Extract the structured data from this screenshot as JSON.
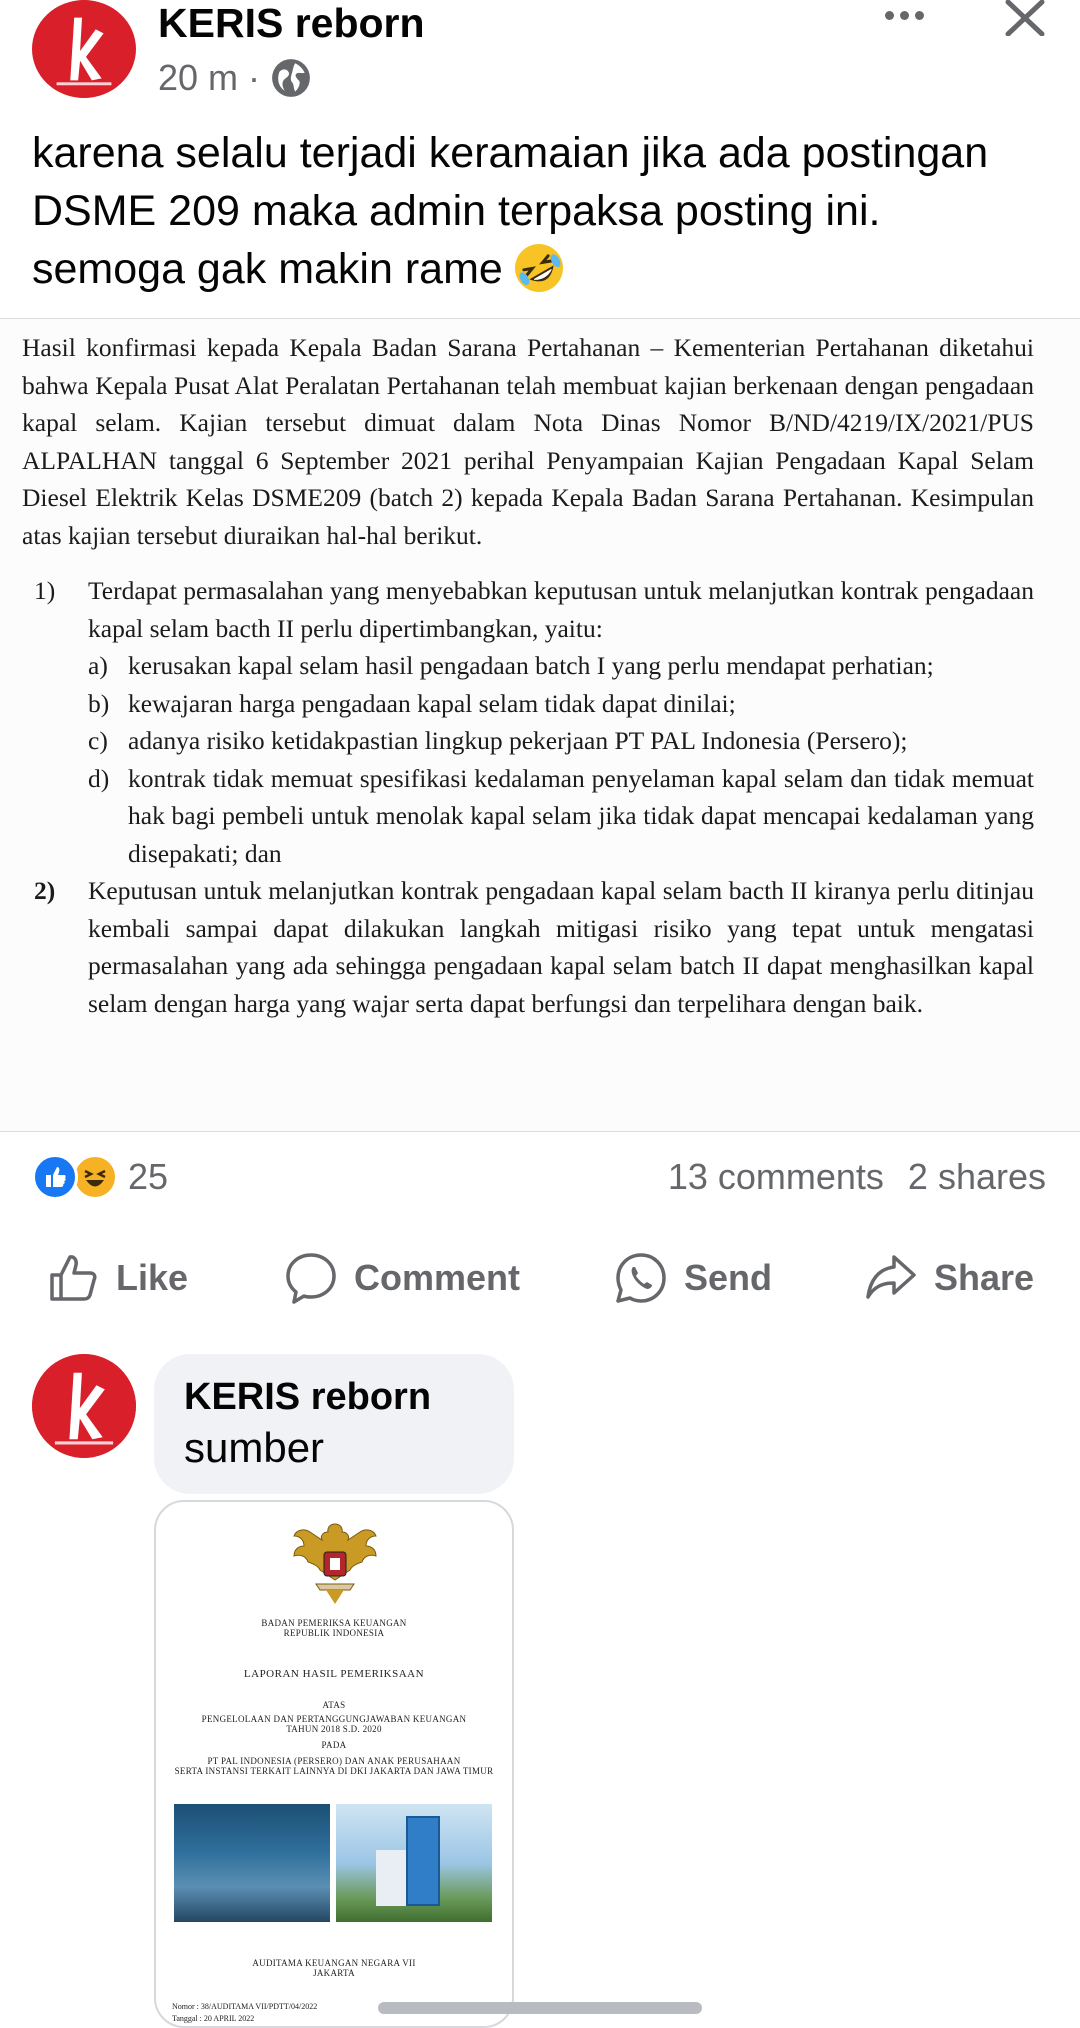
{
  "post": {
    "author": "KERIS reborn",
    "time": "20 m ·",
    "caption_lines": [
      "karena selalu terjadi keramaian jika ada postingan",
      "DSME 209 maka admin terpaksa posting ini.",
      "semoga gak makin rame"
    ],
    "caption_emoji": "rolling-on-floor-laughing-emoji"
  },
  "document": {
    "paragraph": "Hasil konfirmasi kepada Kepala Badan Sarana Pertahanan – Kementerian Pertahanan diketahui bahwa Kepala Pusat Alat Peralatan Pertahanan telah membuat kajian berkenaan dengan pengadaan kapal selam. Kajian tersebut dimuat dalam Nota Dinas Nomor B/ND/4219/IX/2021/PUS ALPALHAN tanggal 6 September 2021 perihal Penyampaian Kajian Pengadaan Kapal Selam Diesel Elektrik Kelas DSME209 (batch 2) kepada Kepala Badan Sarana Pertahanan. Kesimpulan atas kajian tersebut diuraikan hal-hal berikut.",
    "item1_num": "1)",
    "item1_text": "Terdapat permasalahan yang menyebabkan keputusan untuk melanjutkan kontrak pengadaan kapal selam bacth II perlu dipertimbangkan, yaitu:",
    "subitems": [
      {
        "letter": "a)",
        "text": "kerusakan kapal selam hasil pengadaan batch I yang perlu mendapat perhatian;"
      },
      {
        "letter": "b)",
        "text": "kewajaran harga pengadaan kapal selam tidak dapat dinilai;"
      },
      {
        "letter": "c)",
        "text": "adanya risiko ketidakpastian lingkup pekerjaan PT PAL Indonesia (Persero);"
      },
      {
        "letter": "d)",
        "text": "kontrak tidak memuat spesifikasi kedalaman penyelaman kapal selam dan tidak memuat hak bagi pembeli untuk menolak kapal selam jika tidak dapat mencapai kedalaman yang disepakati; dan"
      }
    ],
    "item2_num": "2)",
    "item2_text": "Keputusan untuk melanjutkan kontrak pengadaan kapal selam bacth II kiranya perlu ditinjau kembali sampai dapat dilakukan langkah mitigasi risiko yang tepat untuk mengatasi permasalahan yang ada sehingga pengadaan kapal selam batch II dapat menghasilkan kapal selam dengan harga yang wajar serta dapat berfungsi dan terpelihara dengan baik."
  },
  "reactions": {
    "count": "25",
    "comments": "13 comments",
    "shares": "2 shares",
    "icons": [
      "like-reaction-icon",
      "haha-reaction-icon"
    ]
  },
  "actions": {
    "like": "Like",
    "comment": "Comment",
    "send": "Send",
    "share": "Share"
  },
  "comment": {
    "author": "KERIS reborn",
    "text": "sumber"
  },
  "attachment": {
    "org1": "BADAN PEMERIKSA KEUANGAN",
    "org2": "REPUBLIK INDONESIA",
    "report_title": "LAPORAN HASIL PEMERIKSAAN",
    "atas": "ATAS",
    "subject1": "PENGELOLAAN DAN PERTANGGUNGJAWABAN KEUANGAN",
    "subject2": "TAHUN 2018 S.D. 2020",
    "pada": "PADA",
    "entity1": "PT PAL INDONESIA (PERSERO) DAN ANAK PERUSAHAAN",
    "entity2": "SERTA INSTANSI TERKAIT LAINNYA DI DKI JAKARTA DAN JAWA TIMUR",
    "auditor": "AUDITAMA KEUANGAN NEGARA VII",
    "city": "JAKARTA",
    "nomor": "Nomor   :   38/AUDITAMA VII/PDTT/04/2022",
    "tanggal": "Tanggal  :   20 APRIL 2022"
  },
  "colors": {
    "brand_red": "#d91f2a",
    "like_blue": "#1877f2",
    "secondary_text": "#65676b",
    "bubble_bg": "#f0f2f5"
  }
}
